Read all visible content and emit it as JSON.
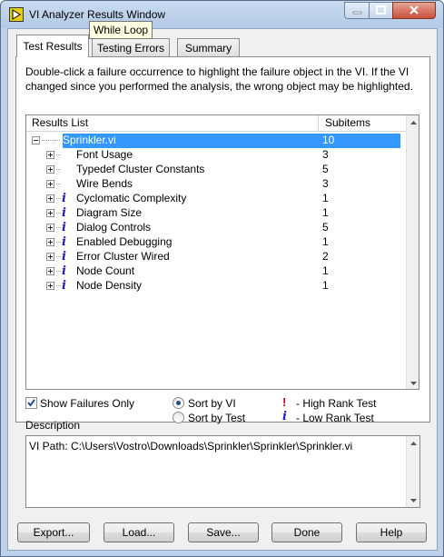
{
  "window": {
    "title": "VI Analyzer Results Window",
    "tooltip": "While Loop"
  },
  "tabs": [
    {
      "label": "Test Results",
      "active": true
    },
    {
      "label": "Testing Errors",
      "active": false
    },
    {
      "label": "Summary",
      "active": false
    }
  ],
  "instructions": "Double-click a failure occurrence to highlight the failure object in the VI.  If the VI changed since you performed the analysis, the wrong object may be highlighted.",
  "results": {
    "columns": [
      "Results List",
      "Subitems"
    ],
    "root": {
      "name": "Sprinkler.vi",
      "count": "10"
    },
    "items": [
      {
        "name": "Font Usage",
        "count": "3",
        "icon": ""
      },
      {
        "name": "Typedef Cluster Constants",
        "count": "5",
        "icon": ""
      },
      {
        "name": "Wire Bends",
        "count": "3",
        "icon": ""
      },
      {
        "name": "Cyclomatic Complexity",
        "count": "1",
        "icon": "i"
      },
      {
        "name": "Diagram Size",
        "count": "1",
        "icon": "i"
      },
      {
        "name": "Dialog Controls",
        "count": "5",
        "icon": "i"
      },
      {
        "name": "Enabled Debugging",
        "count": "1",
        "icon": "i"
      },
      {
        "name": "Error Cluster Wired",
        "count": "2",
        "icon": "i"
      },
      {
        "name": "Node Count",
        "count": "1",
        "icon": "i"
      },
      {
        "name": "Node Density",
        "count": "1",
        "icon": "i"
      }
    ]
  },
  "options": {
    "show_failures_only": "Show Failures Only",
    "sort_by_vi": "Sort by VI",
    "sort_by_test": "Sort by Test",
    "high_rank_icon": "!",
    "high_rank": "- High Rank Test",
    "low_rank_icon": "i",
    "low_rank": "- Low Rank Test"
  },
  "description": {
    "label": "Description",
    "text": "VI Path: C:\\Users\\Vostro\\Downloads\\Sprinkler\\Sprinkler\\Sprinkler.vi"
  },
  "buttons": {
    "export": "Export...",
    "load": "Load...",
    "save": "Save...",
    "done": "Done",
    "help": "Help"
  },
  "colors": {
    "selection": "#3399ff",
    "low_rank": "#1b1bc8",
    "high_rank": "#d40000"
  }
}
